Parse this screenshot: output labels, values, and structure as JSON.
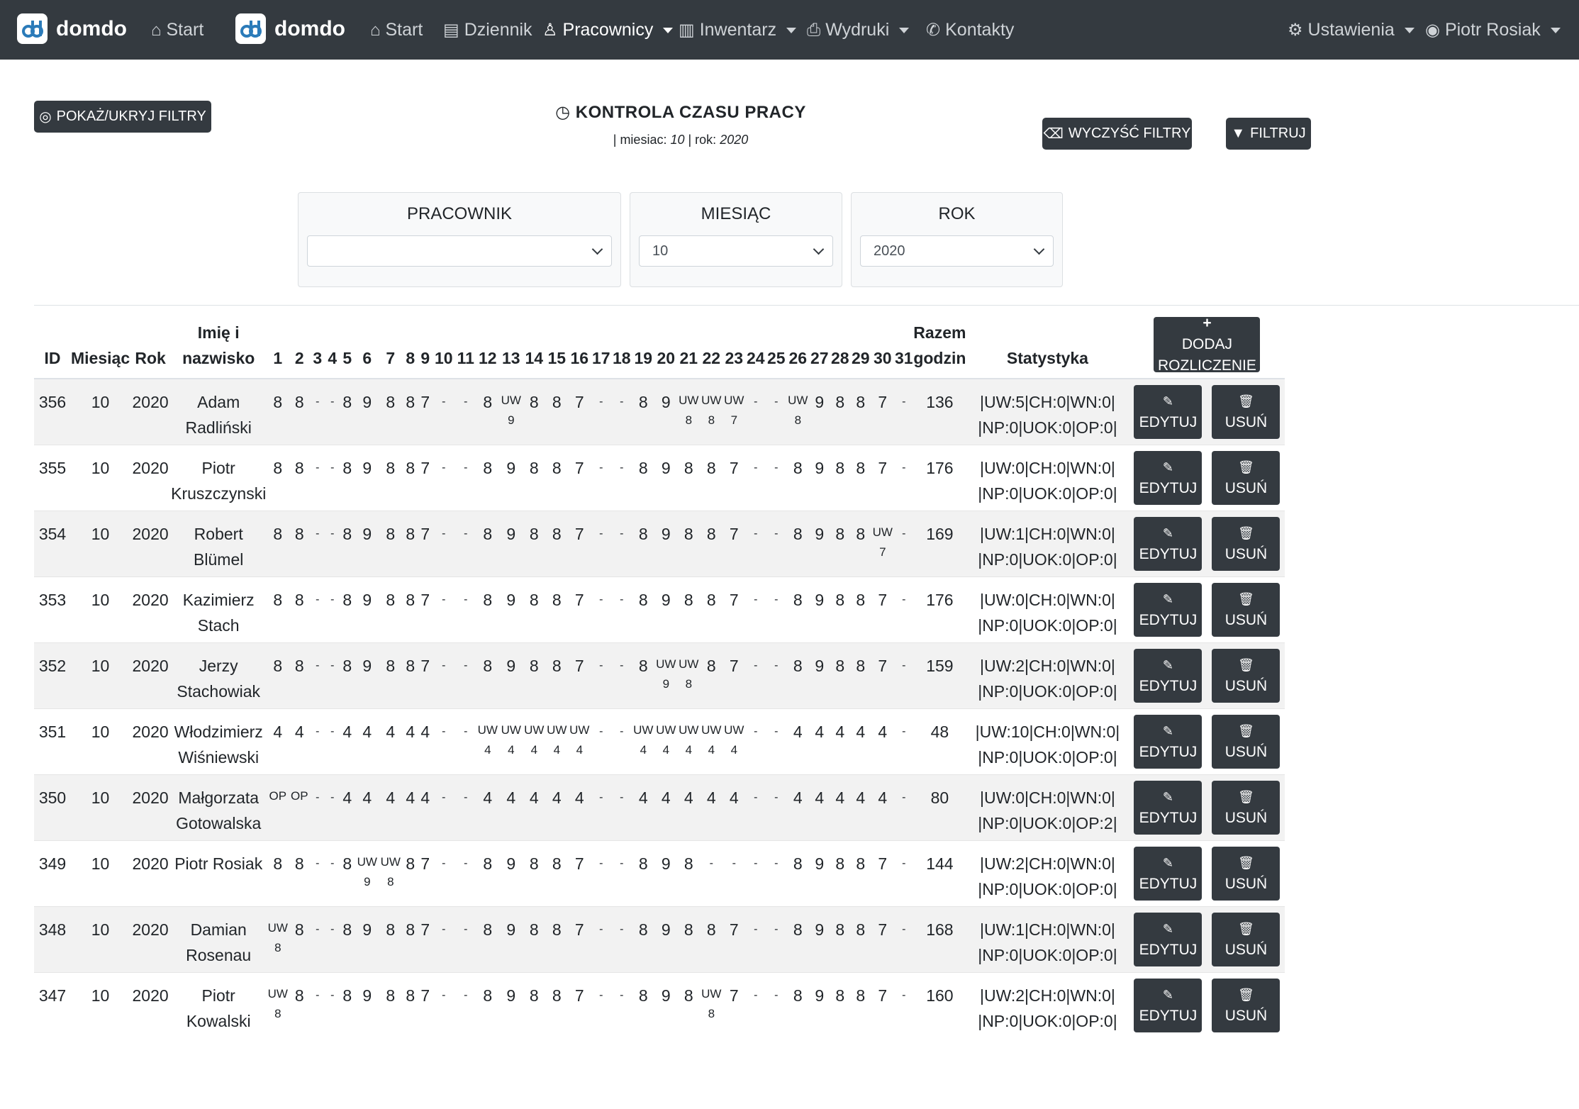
{
  "navbar": {
    "brand1": "domdo",
    "start1": "Start",
    "brand2": "domdo",
    "items": [
      {
        "label": "Start",
        "icon": "home-icon"
      },
      {
        "label": "Dziennik",
        "icon": "book-icon"
      },
      {
        "label": "Pracownicy",
        "icon": "person-icon",
        "dropdown": true,
        "active": true
      },
      {
        "label": "Inwentarz",
        "icon": "building-icon",
        "dropdown": true
      },
      {
        "label": "Wydruki",
        "icon": "printer-icon",
        "dropdown": true
      },
      {
        "label": "Kontakty",
        "icon": "phone-icon"
      }
    ],
    "settings": "Ustawienia",
    "user": "Piotr Rosiak"
  },
  "toolbar": {
    "toggle_filters": "POKAŻ/UKRYJ FILTRY",
    "clear_filters": "WYCZYŚĆ FILTRY",
    "filter": "FILTRUJ"
  },
  "header": {
    "title": "KONTROLA CZASU PRACY",
    "sub_prefix": "| miesiac: ",
    "sub_month": "10",
    "sub_mid": " | rok: ",
    "sub_year": "2020"
  },
  "filters": {
    "employee_label": "PRACOWNIK",
    "employee_value": "",
    "month_label": "MIESIĄC",
    "month_value": "10",
    "year_label": "ROK",
    "year_value": "2020"
  },
  "table": {
    "headers": {
      "id": "ID",
      "month": "Miesiąc",
      "year": "Rok",
      "name": "Imię i nazwisko",
      "days": [
        "1",
        "2",
        "3",
        "4",
        "5",
        "6",
        "7",
        "8",
        "9",
        "10",
        "11",
        "12",
        "13",
        "14",
        "15",
        "16",
        "17",
        "18",
        "19",
        "20",
        "21",
        "22",
        "23",
        "24",
        "25",
        "26",
        "27",
        "28",
        "29",
        "30",
        "31"
      ],
      "total": "Razem godzin",
      "stats": "Statystyka"
    },
    "add_button": "DODAJ ROZLICZENIE",
    "edit_label": "EDYTUJ",
    "delete_label": "USUŃ",
    "rows": [
      {
        "id": "356",
        "month": "10",
        "year": "2020",
        "name": "Adam Radliński",
        "days": [
          "8",
          "8",
          "-",
          "-",
          "8",
          "9",
          "8",
          "8",
          "7",
          "-",
          "-",
          "8",
          "UW|9",
          "8",
          "8",
          "7",
          "-",
          "-",
          "8",
          "9",
          "UW|8",
          "UW|8",
          "UW|7",
          "-",
          "-",
          "UW|8",
          "9",
          "8",
          "8",
          "7",
          "-"
        ],
        "total": "136",
        "stat1": "|UW:5|CH:0|WN:0|",
        "stat2": "|NP:0|UOK:0|OP:0|"
      },
      {
        "id": "355",
        "month": "10",
        "year": "2020",
        "name": "Piotr Kruszczynski",
        "days": [
          "8",
          "8",
          "-",
          "-",
          "8",
          "9",
          "8",
          "8",
          "7",
          "-",
          "-",
          "8",
          "9",
          "8",
          "8",
          "7",
          "-",
          "-",
          "8",
          "9",
          "8",
          "8",
          "7",
          "-",
          "-",
          "8",
          "9",
          "8",
          "8",
          "7",
          "-"
        ],
        "total": "176",
        "stat1": "|UW:0|CH:0|WN:0|",
        "stat2": "|NP:0|UOK:0|OP:0|"
      },
      {
        "id": "354",
        "month": "10",
        "year": "2020",
        "name": "Robert Blümel",
        "days": [
          "8",
          "8",
          "-",
          "-",
          "8",
          "9",
          "8",
          "8",
          "7",
          "-",
          "-",
          "8",
          "9",
          "8",
          "8",
          "7",
          "-",
          "-",
          "8",
          "9",
          "8",
          "8",
          "7",
          "-",
          "-",
          "8",
          "9",
          "8",
          "8",
          "UW|7",
          "-"
        ],
        "total": "169",
        "stat1": "|UW:1|CH:0|WN:0|",
        "stat2": "|NP:0|UOK:0|OP:0|"
      },
      {
        "id": "353",
        "month": "10",
        "year": "2020",
        "name": "Kazimierz Stach",
        "days": [
          "8",
          "8",
          "-",
          "-",
          "8",
          "9",
          "8",
          "8",
          "7",
          "-",
          "-",
          "8",
          "9",
          "8",
          "8",
          "7",
          "-",
          "-",
          "8",
          "9",
          "8",
          "8",
          "7",
          "-",
          "-",
          "8",
          "9",
          "8",
          "8",
          "7",
          "-"
        ],
        "total": "176",
        "stat1": "|UW:0|CH:0|WN:0|",
        "stat2": "|NP:0|UOK:0|OP:0|"
      },
      {
        "id": "352",
        "month": "10",
        "year": "2020",
        "name": "Jerzy Stachowiak",
        "days": [
          "8",
          "8",
          "-",
          "-",
          "8",
          "9",
          "8",
          "8",
          "7",
          "-",
          "-",
          "8",
          "9",
          "8",
          "8",
          "7",
          "-",
          "-",
          "8",
          "UW|9",
          "UW|8",
          "8",
          "7",
          "-",
          "-",
          "8",
          "9",
          "8",
          "8",
          "7",
          "-"
        ],
        "total": "159",
        "stat1": "|UW:2|CH:0|WN:0|",
        "stat2": "|NP:0|UOK:0|OP:0|"
      },
      {
        "id": "351",
        "month": "10",
        "year": "2020",
        "name": "Włodzimierz Wiśniewski",
        "days": [
          "4",
          "4",
          "-",
          "-",
          "4",
          "4",
          "4",
          "4",
          "4",
          "-",
          "-",
          "UW|4",
          "UW|4",
          "UW|4",
          "UW|4",
          "UW|4",
          "-",
          "-",
          "UW|4",
          "UW|4",
          "UW|4",
          "UW|4",
          "UW|4",
          "-",
          "-",
          "4",
          "4",
          "4",
          "4",
          "4",
          "-"
        ],
        "total": "48",
        "stat1": "|UW:10|CH:0|WN:0|",
        "stat2": "|NP:0|UOK:0|OP:0|"
      },
      {
        "id": "350",
        "month": "10",
        "year": "2020",
        "name": "Małgorzata Gotowalska",
        "days": [
          "OP|",
          "OP|",
          "-",
          "-",
          "4",
          "4",
          "4",
          "4",
          "4",
          "-",
          "-",
          "4",
          "4",
          "4",
          "4",
          "4",
          "-",
          "-",
          "4",
          "4",
          "4",
          "4",
          "4",
          "-",
          "-",
          "4",
          "4",
          "4",
          "4",
          "4",
          "-"
        ],
        "total": "80",
        "stat1": "|UW:0|CH:0|WN:0|",
        "stat2": "|NP:0|UOK:0|OP:2|"
      },
      {
        "id": "349",
        "month": "10",
        "year": "2020",
        "name": "Piotr Rosiak",
        "days": [
          "8",
          "8",
          "-",
          "-",
          "8",
          "UW|9",
          "UW|8",
          "8",
          "7",
          "-",
          "-",
          "8",
          "9",
          "8",
          "8",
          "7",
          "-",
          "-",
          "8",
          "9",
          "8",
          "-",
          "-",
          "-",
          "-",
          "8",
          "9",
          "8",
          "8",
          "7",
          "-"
        ],
        "total": "144",
        "stat1": "|UW:2|CH:0|WN:0|",
        "stat2": "|NP:0|UOK:0|OP:0|"
      },
      {
        "id": "348",
        "month": "10",
        "year": "2020",
        "name": "Damian Rosenau",
        "days": [
          "UW|8",
          "8",
          "-",
          "-",
          "8",
          "9",
          "8",
          "8",
          "7",
          "-",
          "-",
          "8",
          "9",
          "8",
          "8",
          "7",
          "-",
          "-",
          "8",
          "9",
          "8",
          "8",
          "7",
          "-",
          "-",
          "8",
          "9",
          "8",
          "8",
          "7",
          "-"
        ],
        "total": "168",
        "stat1": "|UW:1|CH:0|WN:0|",
        "stat2": "|NP:0|UOK:0|OP:0|"
      },
      {
        "id": "347",
        "month": "10",
        "year": "2020",
        "name": "Piotr Kowalski",
        "days": [
          "UW|8",
          "8",
          "-",
          "-",
          "8",
          "9",
          "8",
          "8",
          "7",
          "-",
          "-",
          "8",
          "9",
          "8",
          "8",
          "7",
          "-",
          "-",
          "8",
          "9",
          "8",
          "UW|8",
          "7",
          "-",
          "-",
          "8",
          "9",
          "8",
          "8",
          "7",
          "-"
        ],
        "total": "160",
        "stat1": "|UW:2|CH:0|WN:0|",
        "stat2": "|NP:0|UOK:0|OP:0|"
      }
    ]
  }
}
